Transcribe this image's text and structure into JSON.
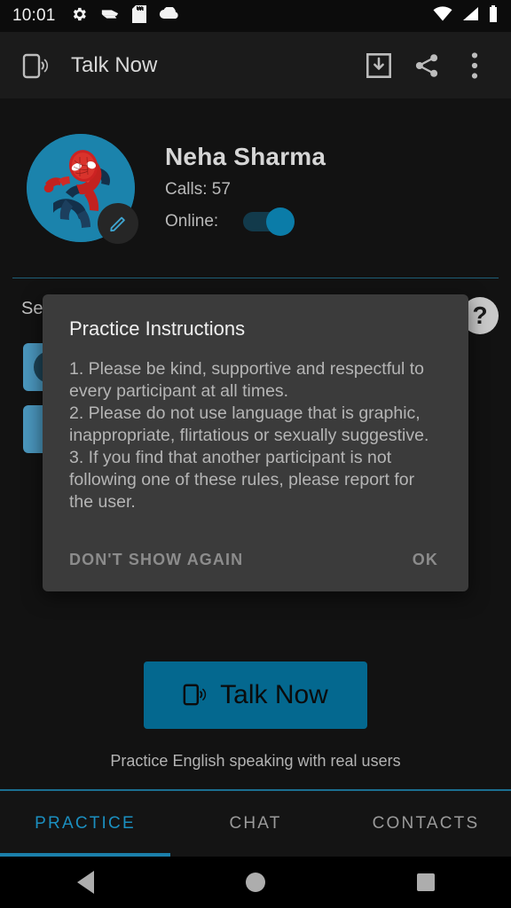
{
  "status_bar": {
    "time": "10:01",
    "left_icons": [
      "gear-icon",
      "stapler-icon",
      "sd-card-icon",
      "cloud-icon"
    ],
    "right_icons": [
      "wifi-icon",
      "signal-icon",
      "battery-icon"
    ]
  },
  "app_bar": {
    "nav_icon": "phone-ring-icon",
    "title": "Talk Now",
    "actions": [
      "download-icon",
      "share-icon",
      "overflow-menu-icon"
    ]
  },
  "profile": {
    "avatar_alt": "spiderman-avatar",
    "edit_icon": "pencil-icon",
    "name": "Neha Sharma",
    "calls_label": "Calls: 57",
    "online_label": "Online:",
    "online_state": "on"
  },
  "settings": {
    "section_label": "Se",
    "help_label": "?",
    "chips": [
      {
        "name": "setting-chip-1"
      },
      {
        "name": "setting-chip-2"
      }
    ]
  },
  "dialog": {
    "title": "Practice Instructions",
    "body": "1. Please be kind, supportive and respectful to every participant at all times.\n2. Please do not use language that is graphic, inappropriate, flirtatious or sexually suggestive.\n3. If you find that another participant is not following one of these rules, please report for the user.",
    "negative_label": "DON'T SHOW AGAIN",
    "positive_label": "OK"
  },
  "main": {
    "talk_now_label": "Talk Now",
    "talk_now_icon": "phone-ring-icon",
    "tagline": "Practice English speaking with real users"
  },
  "tabs": [
    {
      "label": "PRACTICE",
      "active": true
    },
    {
      "label": "CHAT",
      "active": false
    },
    {
      "label": "CONTACTS",
      "active": false
    }
  ],
  "nav_bar": {
    "back": "back-triangle-icon",
    "home": "home-circle-icon",
    "recents": "recents-square-icon"
  },
  "colors": {
    "accent": "#04688f",
    "accent_light": "#1b8fc0",
    "avatar_bg": "#1b83ac",
    "dialog_bg": "#3b3b3b",
    "page_bg": "#121212"
  }
}
